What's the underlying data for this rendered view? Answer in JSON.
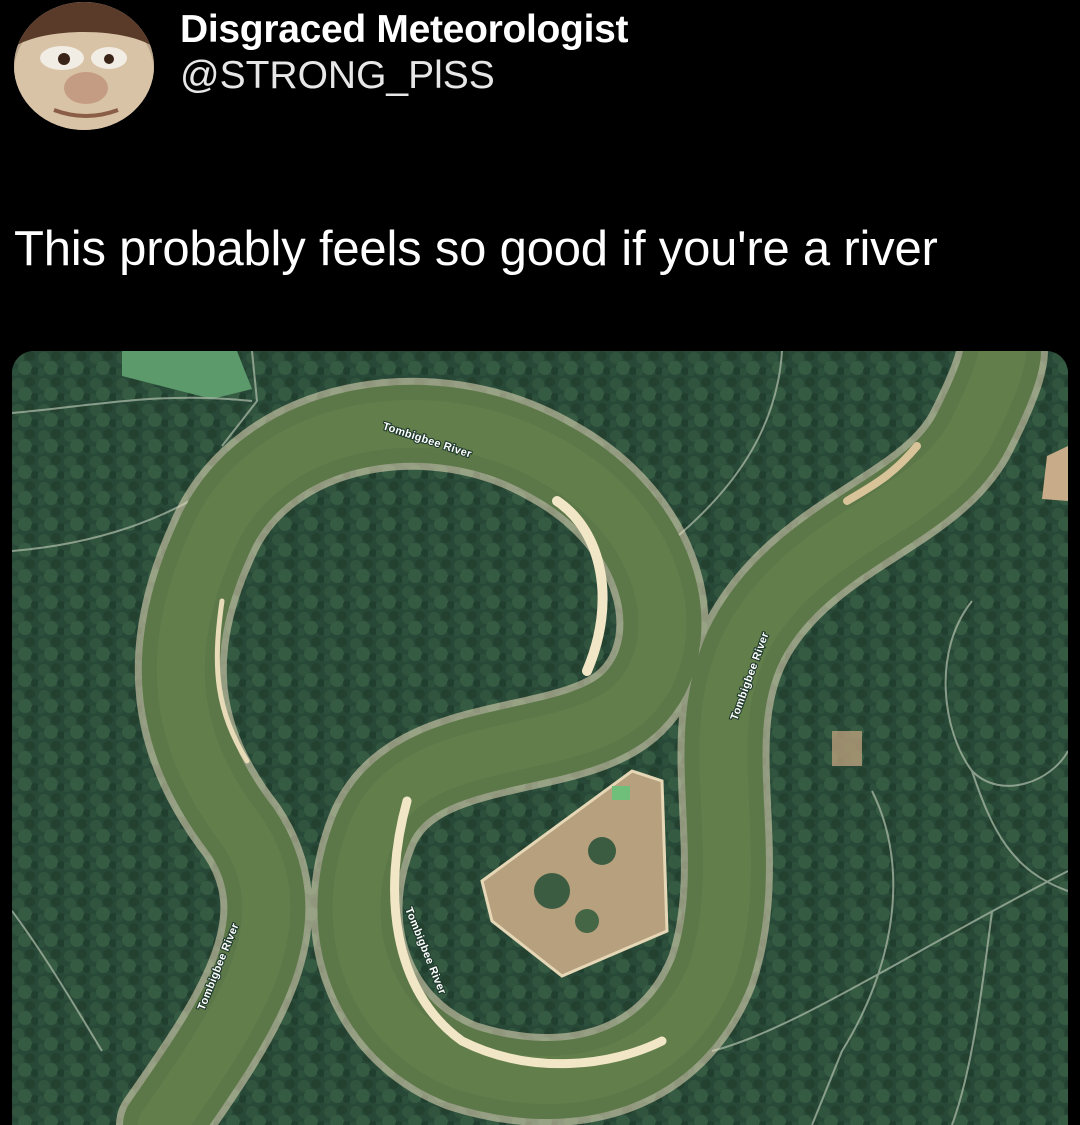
{
  "author": {
    "display_name": "Disgraced Meteorologist",
    "handle": "@STRONG_PlSS",
    "avatar_icon": "gremlin-face-avatar"
  },
  "tweet": {
    "text": "This probably feels so good if you're a river"
  },
  "media": {
    "type": "satellite-map",
    "colors": {
      "forest": "#2b4f3c",
      "river": "#5f7a49",
      "sandbar": "#efe1bd",
      "clearing": "#b69d7a"
    },
    "labels": [
      "Tombigbee River",
      "Tombigbee River",
      "Tombigbee River",
      "Tombigbee River"
    ]
  }
}
